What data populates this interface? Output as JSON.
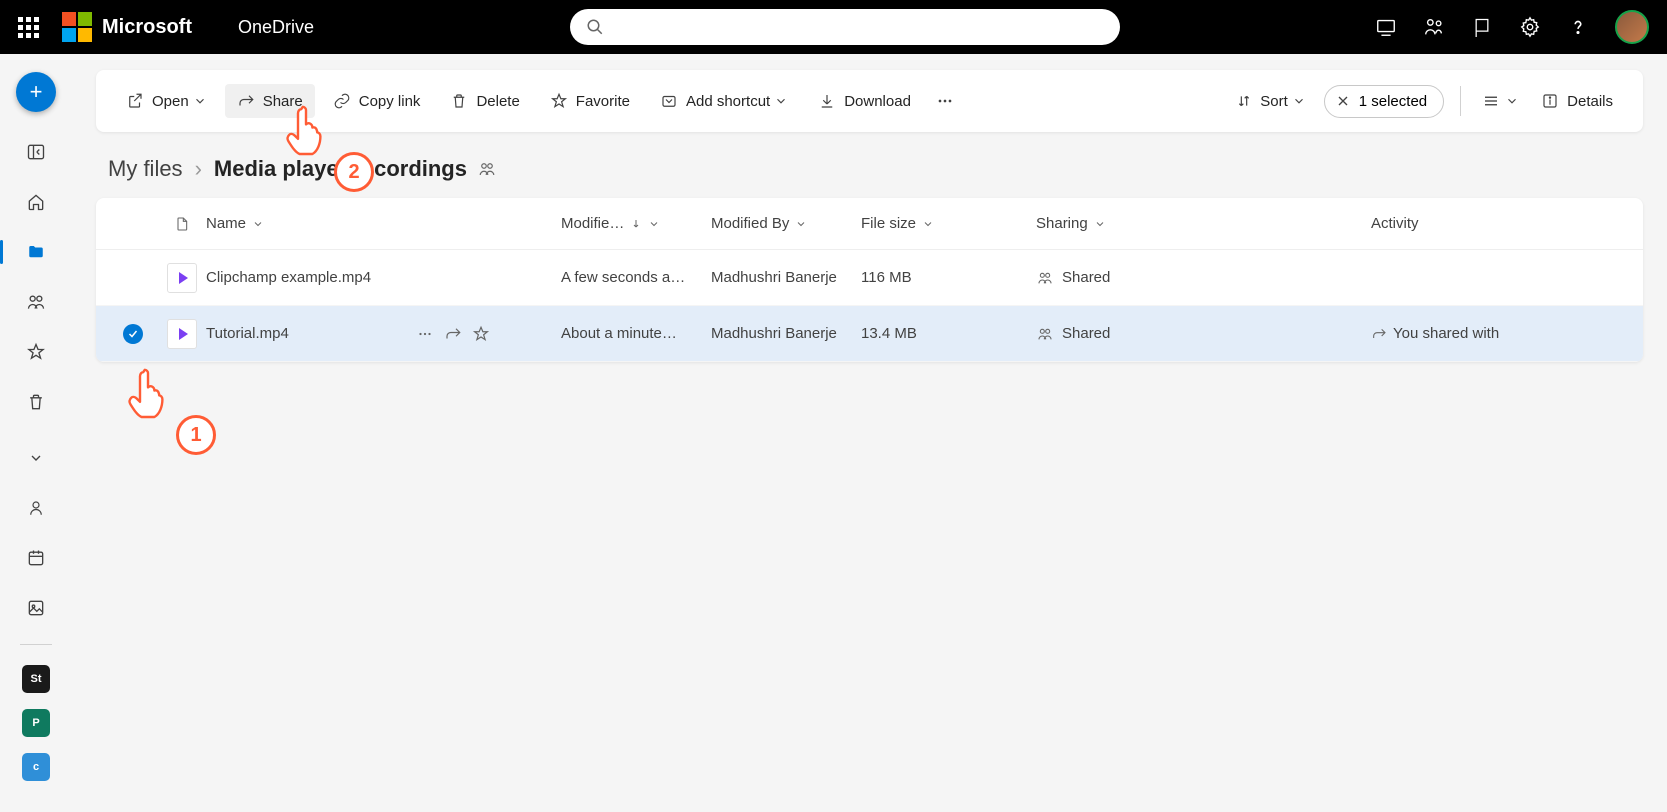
{
  "header": {
    "brand": "Microsoft",
    "appName": "OneDrive"
  },
  "commandBar": {
    "open": "Open",
    "share": "Share",
    "copyLink": "Copy link",
    "delete": "Delete",
    "favorite": "Favorite",
    "addShortcut": "Add shortcut",
    "download": "Download",
    "sort": "Sort",
    "selected": "1 selected",
    "details": "Details"
  },
  "breadcrumb": {
    "root": "My files",
    "current": "Media player recordings"
  },
  "columns": {
    "name": "Name",
    "modified": "Modifie…",
    "modifiedBy": "Modified By",
    "fileSize": "File size",
    "sharing": "Sharing",
    "activity": "Activity"
  },
  "rows": [
    {
      "name": "Clipchamp example.mp4",
      "modified": "A few seconds a…",
      "modifiedBy": "Madhushri Banerje",
      "size": "116 MB",
      "sharing": "Shared",
      "activity": "",
      "selected": false
    },
    {
      "name": "Tutorial.mp4",
      "modified": "About a minute…",
      "modifiedBy": "Madhushri Banerje",
      "size": "13.4 MB",
      "sharing": "Shared",
      "activity": "You shared with",
      "selected": true
    }
  ],
  "callouts": {
    "one": "1",
    "two": "2"
  }
}
